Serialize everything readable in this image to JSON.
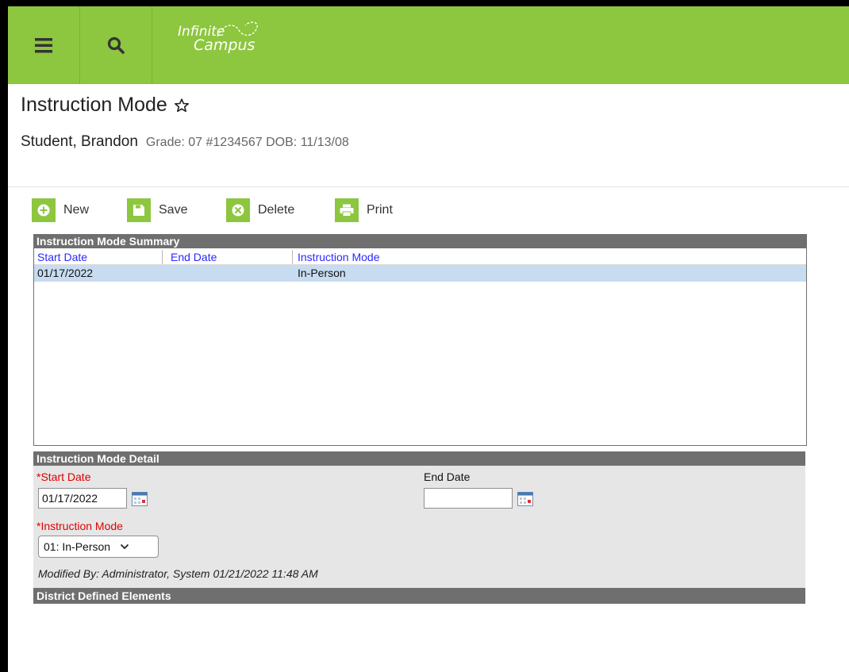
{
  "header": {
    "logo_line1": "Infinite",
    "logo_line2": "Campus"
  },
  "page": {
    "title": "Instruction Mode",
    "student_name": "Student, Brandon",
    "student_meta": "Grade: 07 #1234567 DOB: 11/13/08"
  },
  "toolbar": {
    "new_label": "New",
    "save_label": "Save",
    "delete_label": "Delete",
    "print_label": "Print"
  },
  "summary": {
    "title": "Instruction Mode Summary",
    "columns": [
      "Start Date",
      "End Date",
      "Instruction Mode"
    ],
    "rows": [
      {
        "start_date": "01/17/2022",
        "end_date": "",
        "mode": "In-Person"
      }
    ]
  },
  "detail": {
    "title": "Instruction Mode Detail",
    "start_date_label": "*Start Date",
    "start_date_value": "01/17/2022",
    "end_date_label": "End Date",
    "end_date_value": "",
    "mode_label": "*Instruction Mode",
    "mode_value": "01: In-Person",
    "modified_text": "Modified By: Administrator, System 01/21/2022 11:48 AM",
    "district_title": "District Defined Elements"
  },
  "colors": {
    "brand_green": "#8dc63f",
    "panel_header": "#6f6f6f",
    "required_red": "#e00000",
    "link_blue": "#2a2aff",
    "selected_row": "#c7dcf0"
  }
}
